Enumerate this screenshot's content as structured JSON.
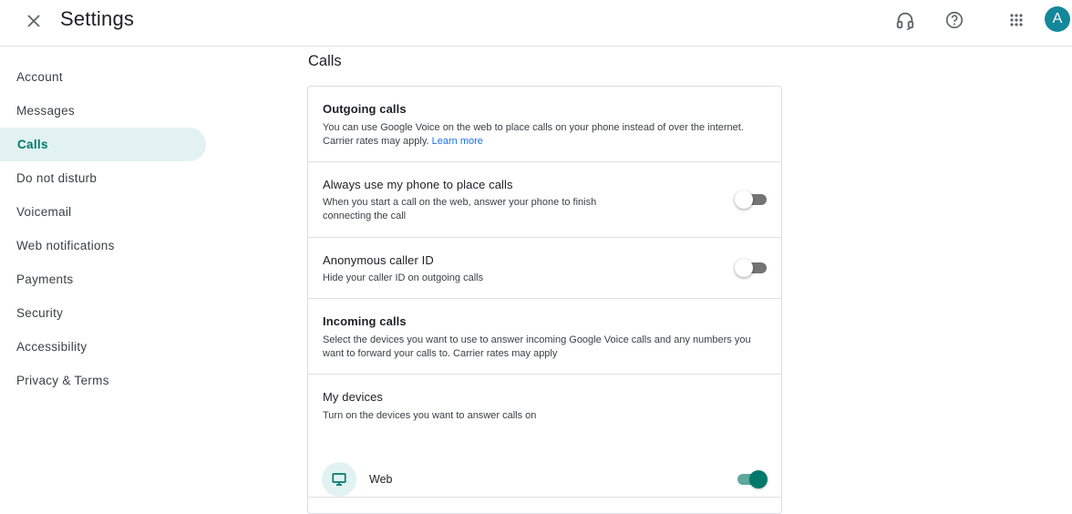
{
  "header": {
    "title": "Settings",
    "avatar_letter": "A"
  },
  "sidebar": {
    "items": [
      {
        "label": "Account",
        "active": false
      },
      {
        "label": "Messages",
        "active": false
      },
      {
        "label": "Calls",
        "active": true
      },
      {
        "label": "Do not disturb",
        "active": false
      },
      {
        "label": "Voicemail",
        "active": false
      },
      {
        "label": "Web notifications",
        "active": false
      },
      {
        "label": "Payments",
        "active": false
      },
      {
        "label": "Security",
        "active": false
      },
      {
        "label": "Accessibility",
        "active": false
      },
      {
        "label": "Privacy & Terms",
        "active": false
      }
    ]
  },
  "main": {
    "section_title": "Calls",
    "outgoing": {
      "title": "Outgoing calls",
      "desc": "You can use Google Voice on the web to place calls on your phone instead of over the internet. Carrier rates may apply.",
      "link": "Learn more"
    },
    "always_phone": {
      "title": "Always use my phone to place calls",
      "desc": "When you start a call on the web, answer your phone to finish connecting the call",
      "enabled": false
    },
    "anonymous": {
      "title": "Anonymous caller ID",
      "desc": "Hide your caller ID on outgoing calls",
      "enabled": false
    },
    "incoming": {
      "title": "Incoming calls",
      "desc": "Select the devices you want to use to answer incoming Google Voice calls and any numbers you want to forward your calls to. Carrier rates may apply"
    },
    "my_devices": {
      "title": "My devices",
      "desc": "Turn on the devices you want to answer calls on",
      "devices": [
        {
          "label": "Web",
          "icon": "monitor-icon",
          "enabled": true
        }
      ]
    }
  },
  "colors": {
    "accent": "#00796b",
    "active_bg": "#e2f2f2",
    "link": "#1a73e8",
    "avatar": "#13889b"
  }
}
